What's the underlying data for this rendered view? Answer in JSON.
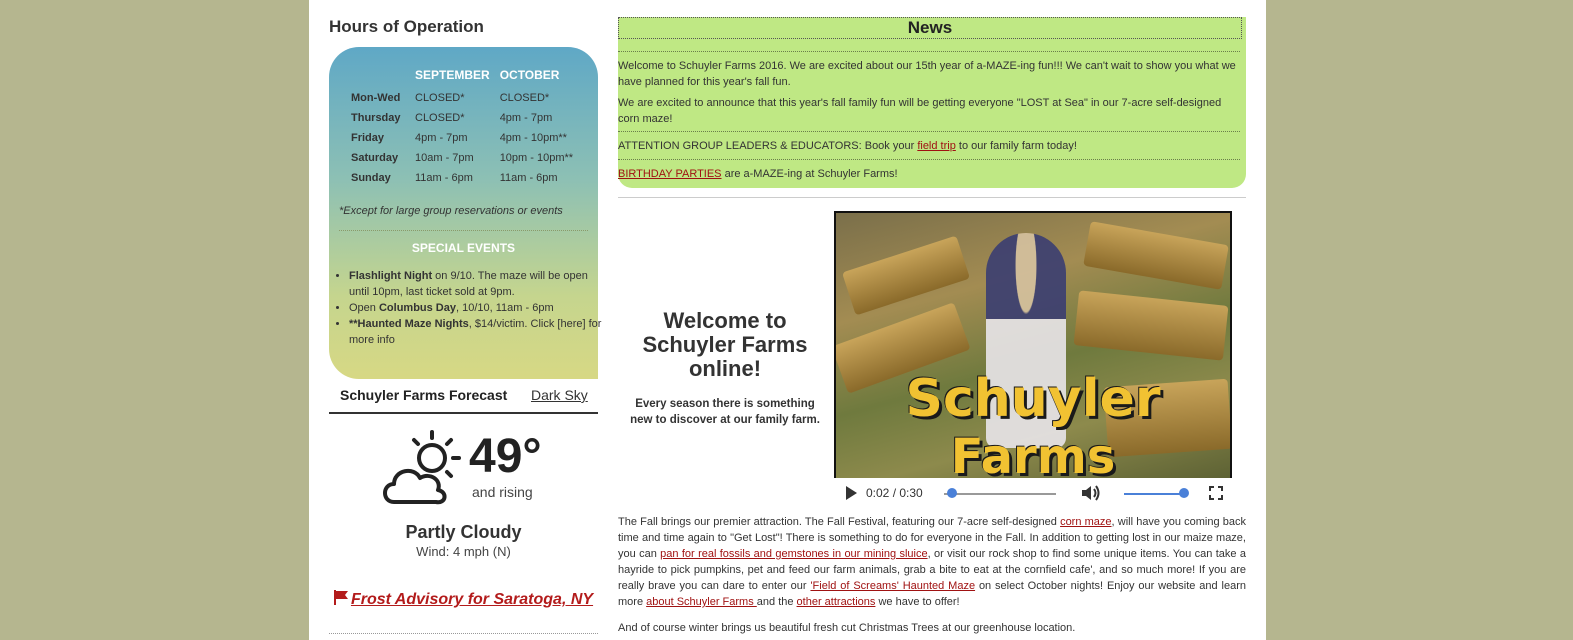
{
  "hours": {
    "title": "Hours of Operation",
    "columns": [
      "SEPTEMBER",
      "OCTOBER"
    ],
    "rows": [
      {
        "day": "Mon-Wed",
        "sep": "CLOSED*",
        "oct": "CLOSED*"
      },
      {
        "day": "Thursday",
        "sep": "CLOSED*",
        "oct": "4pm - 7pm"
      },
      {
        "day": "Friday",
        "sep": "4pm - 7pm",
        "oct": "4pm - 10pm**"
      },
      {
        "day": "Saturday",
        "sep": "10am - 7pm",
        "oct": "10pm - 10pm**"
      },
      {
        "day": "Sunday",
        "sep": "11am - 6pm",
        "oct": "11am - 6pm"
      }
    ],
    "note": "*Except for large group reservations or events",
    "special_title": "SPECIAL EVENTS",
    "special_events": [
      {
        "bold": "Flashlight Night",
        "rest": " on 9/10. The maze will be open until 10pm, last ticket sold at 9pm."
      },
      {
        "pre": "Open ",
        "bold": "Columbus Day",
        "rest": ", 10/10, 11am - 6pm"
      },
      {
        "bold": "**Haunted Maze Nights",
        "rest": ", $14/victim. Click [here] for more info"
      }
    ]
  },
  "forecast": {
    "tab_label": "Schuyler Farms Forecast",
    "link_label": "Dark Sky",
    "icon": "partly-cloudy-day-icon",
    "temp": "49°",
    "trend": "and rising",
    "condition": "Partly Cloudy",
    "wind": "Wind: 4 mph (N)",
    "advisory": "Frost Advisory for Saratoga, NY"
  },
  "news": {
    "title": "News",
    "p1": "Welcome to Schuyler Farms 2016. We are excited about our 15th year of a-MAZE-ing fun!!! We can't wait to show you what we have planned for this year's fall fun.",
    "p2": "We are excited to announce that this year's fall family fun will be getting everyone \"LOST at Sea\" in our 7-acre self-designed corn maze!",
    "p3_pre": "ATTENTION GROUP LEADERS & EDUCATORS: Book your ",
    "p3_link": "field trip",
    "p3_post": " to our family farm today!",
    "p4_link": "BIRTHDAY PARTIES",
    "p4_post": " are a-MAZE-ing at Schuyler Farms!"
  },
  "welcome": {
    "title": "Welcome to Schuyler Farms online!",
    "subtitle": "Every season there is something new to discover at our family farm."
  },
  "video": {
    "logo_line1": "Schuyler",
    "logo_line2": "Farms",
    "time": "0:02 / 0:30",
    "progress": 0.07,
    "volume": 1.0
  },
  "body": {
    "t1": "The Fall brings our premier attraction. The Fall Festival, featuring our 7-acre self-designed ",
    "l1": "corn maze",
    "t2": ", will have you coming back time and time again to \"Get Lost\"! There is something to do for everyone in the Fall. In addition to getting lost in our maize maze, you can ",
    "l2": "pan for real fossils and gemstones in our mining sluice",
    "t3": ", or visit our rock shop to find some unique items. You can take a hayride to pick pumpkins, pet and feed our farm animals, grab a bite to eat at the cornfield cafe', and so much more! If you are really brave you can dare to enter our ",
    "l3": "'Field of Screams' Haunted Maze",
    "t4": " on select October nights! Enjoy our website and learn more ",
    "l4": "about Schuyler Farms ",
    "t5": "and the ",
    "l5": "other attractions",
    "t6": " we have to offer!",
    "winter": "And of course winter brings us beautiful fresh cut Christmas Trees at our greenhouse location."
  }
}
